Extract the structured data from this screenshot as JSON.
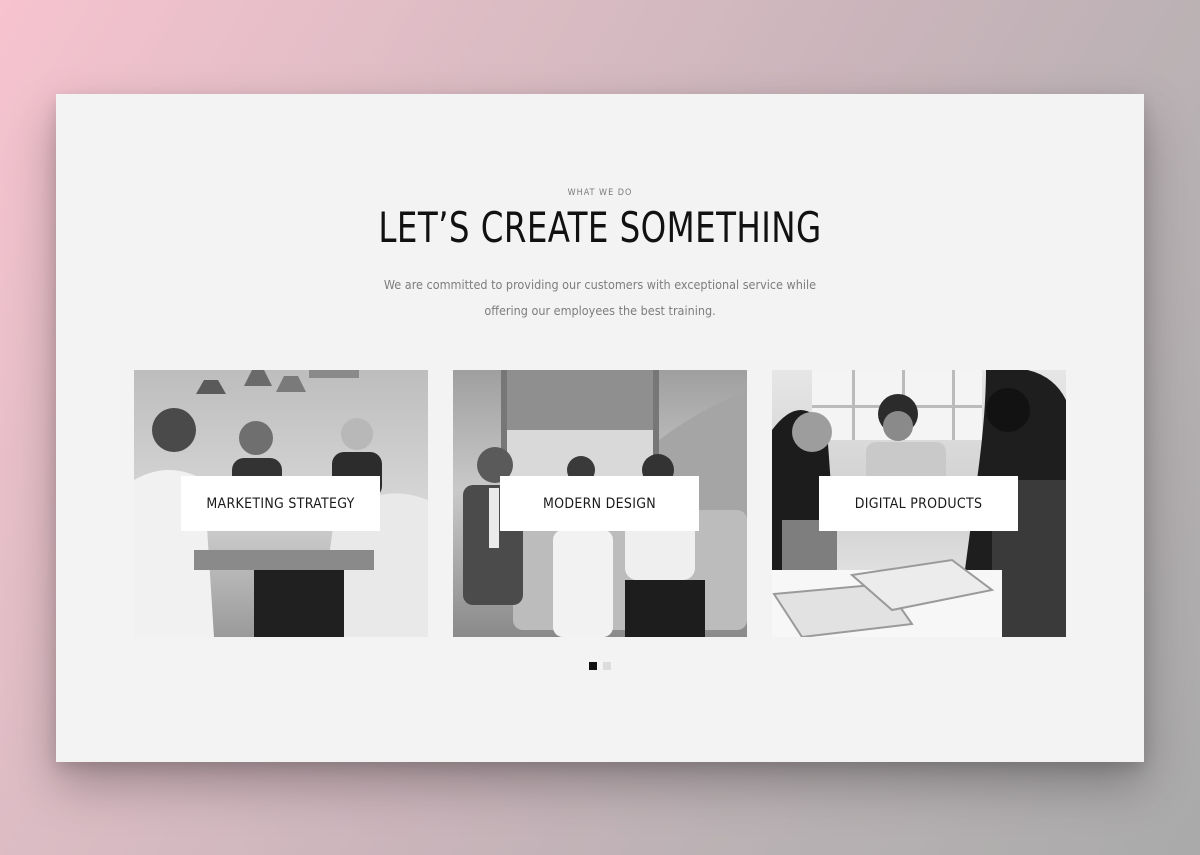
{
  "section": {
    "eyebrow": "WHAT WE DO",
    "title": "LET’S CREATE SOMETHING",
    "description_line1": "We are committed to providing our customers with exceptional service while",
    "description_line2": "offering our employees the best training."
  },
  "services": [
    {
      "label": "MARKETING STRATEGY"
    },
    {
      "label": "MODERN DESIGN"
    },
    {
      "label": "DIGITAL PRODUCTS"
    }
  ],
  "pagination": {
    "total": 2,
    "active": 1
  },
  "colors": {
    "card_background": "#f3f3f3",
    "title": "#111111",
    "muted_text": "#7d7d7d",
    "dot_active": "#111111",
    "dot_inactive": "#dcdcdc"
  }
}
